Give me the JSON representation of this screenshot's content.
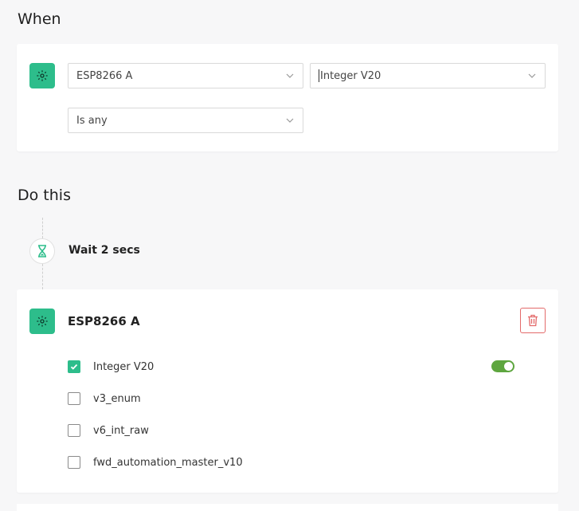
{
  "when": {
    "title": "When",
    "device_select": {
      "value": "ESP8266 A"
    },
    "datastream_select": {
      "value": "Integer V20"
    },
    "condition_select": {
      "value": "Is any"
    }
  },
  "do_this": {
    "title": "Do this",
    "wait": {
      "label": "Wait 2 secs"
    },
    "device_action": {
      "title": "ESP8266 A",
      "options": [
        {
          "label": "Integer V20",
          "checked": true,
          "toggle_on": true
        },
        {
          "label": "v3_enum",
          "checked": false
        },
        {
          "label": "v6_int_raw",
          "checked": false
        },
        {
          "label": "fwd_automation_master_v10",
          "checked": false
        }
      ]
    }
  },
  "icons": {
    "trigger_device": "gear-icon",
    "wait": "hourglass-icon",
    "action_device": "gear-icon",
    "delete": "trash-icon",
    "dropdown": "chevron-down-icon",
    "checked": "check-icon"
  },
  "colors": {
    "accent_green": "#2dbd8b",
    "toggle_green": "#5ea63f",
    "delete_red": "#e36a6a"
  }
}
